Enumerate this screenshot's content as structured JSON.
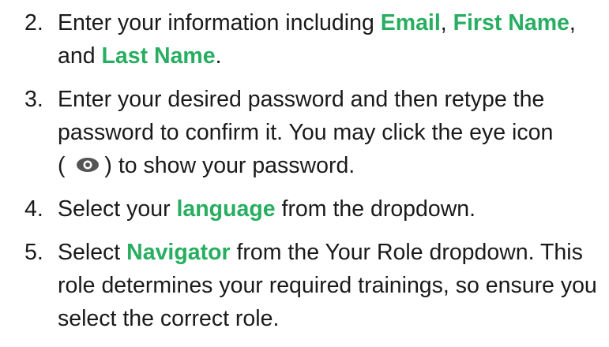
{
  "colors": {
    "highlight": "#27ae60",
    "text": "#1a1a1a"
  },
  "steps": [
    {
      "number": "2.",
      "parts": [
        "Enter your information including ",
        "Email",
        ", ",
        "First Name",
        ", ",
        "and ",
        "Last Name",
        "."
      ]
    },
    {
      "number": "3.",
      "parts": [
        "Enter your desired password and then retype the password to confirm it. You may click the eye icon",
        "( ",
        ") to show your password."
      ],
      "icon": "eye-icon"
    },
    {
      "number": "4.",
      "parts": [
        "Select your ",
        "language",
        " from the dropdown."
      ]
    },
    {
      "number": "5.",
      "parts": [
        "Select ",
        "Navigator",
        " from the Your Role dropdown. This role determines your required trainings, so ensure you select the correct role."
      ]
    }
  ]
}
